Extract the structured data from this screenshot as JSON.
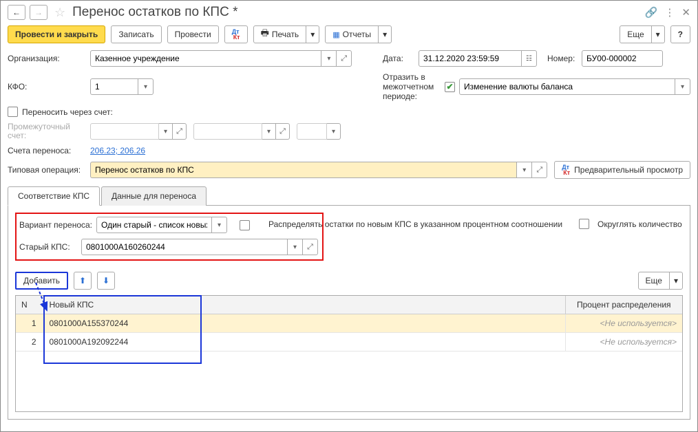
{
  "title": "Перенос остатков по КПС *",
  "toolbar": {
    "submit_close": "Провести и закрыть",
    "save": "Записать",
    "submit": "Провести",
    "print": "Печать",
    "reports": "Отчеты",
    "more": "Еще",
    "help": "?"
  },
  "labels": {
    "org": "Организация:",
    "date": "Дата:",
    "number": "Номер:",
    "kfo": "КФО:",
    "interperiod": "Отразить в межотчетном периоде:",
    "carry_via": "Переносить через счет:",
    "intermed_acc": "Промежуточный счет:",
    "transfer_acc": "Счета переноса:",
    "typical_op": "Типовая операция:",
    "preview": "Предварительный просмотр",
    "variant": "Вариант переноса:",
    "distribute": "Распределять остатки по новым КПС в указанном процентном соотношении",
    "round_qty": "Округлять количество",
    "old_kps": "Старый КПС:",
    "add": "Добавить"
  },
  "values": {
    "org": "Казенное учреждение",
    "date": "31.12.2020 23:59:59",
    "number": "БУ00-000002",
    "kfo": "1",
    "interperiod_sel": "Изменение валюты баланса",
    "transfer_acc_link": "206.23; 206.26",
    "typical_op": "Перенос остатков по КПС",
    "variant": "Один старый - список новых",
    "old_kps": "0801000А160260244"
  },
  "tabs": {
    "t1": "Соответствие КПС",
    "t2": "Данные для переноса"
  },
  "table": {
    "col_n": "N",
    "col_new": "Новый КПС",
    "col_pct": "Процент распределения",
    "not_used": "<Не используется>",
    "rows": [
      {
        "n": "1",
        "kps": "0801000А155370244"
      },
      {
        "n": "2",
        "kps": "0801000А192092244"
      }
    ]
  }
}
